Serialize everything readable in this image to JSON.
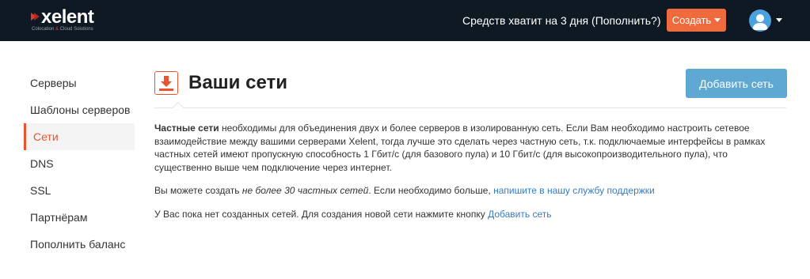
{
  "header": {
    "logo_text": "xelent",
    "logo_tagline_a": "Colocation",
    "logo_tagline_amp": "&",
    "logo_tagline_b": "Cloud Solutions",
    "balance_text": "Средств хватит на 3 дня (Пополнить?)",
    "create_label": "Создать",
    "colors": {
      "bar": "#0f1923",
      "create": "#ef6a3d",
      "avatar": "#4aa3df"
    }
  },
  "sidebar": {
    "items": [
      {
        "label": "Серверы"
      },
      {
        "label": "Шаблоны серверов"
      },
      {
        "label": "Сети",
        "active": true
      },
      {
        "label": "DNS"
      },
      {
        "label": "SSL"
      },
      {
        "label": "Партнёрам"
      },
      {
        "label": "Пополнить баланс"
      }
    ],
    "active_color": "#e8552f"
  },
  "main": {
    "title": "Ваши сети",
    "icon": "download-icon",
    "add_button_label": "Добавить сеть",
    "add_button_color": "#5ea8d3",
    "para1_bold": "Частные сети",
    "para1_rest": " необходимы для объединения двух и более серверов в изолированную сеть. Если Вам необходимо настроить сетевое взаимодействие между вашими серверами Xelent, тогда лучше это сделать через частную сеть, т.к. подключаемые интерфейсы в рамках частных сетей имеют пропускную способность 1 Гбит/с (для базового пула) и 10 Гбит/с (для высокопроизводительного пула), что существенно выше чем подключение через интернет.",
    "para2_a": "Вы можете создать ",
    "para2_italic": "не более 30 частных сетей",
    "para2_b": ". Если необходимо больше, ",
    "para2_link": "напишите в нашу службу поддержки",
    "para3_text": "У Вас пока нет созданных сетей. Для создания новой сети нажмите кнопку ",
    "para3_link": "Добавить сеть",
    "link_color": "#3a7bbf"
  }
}
